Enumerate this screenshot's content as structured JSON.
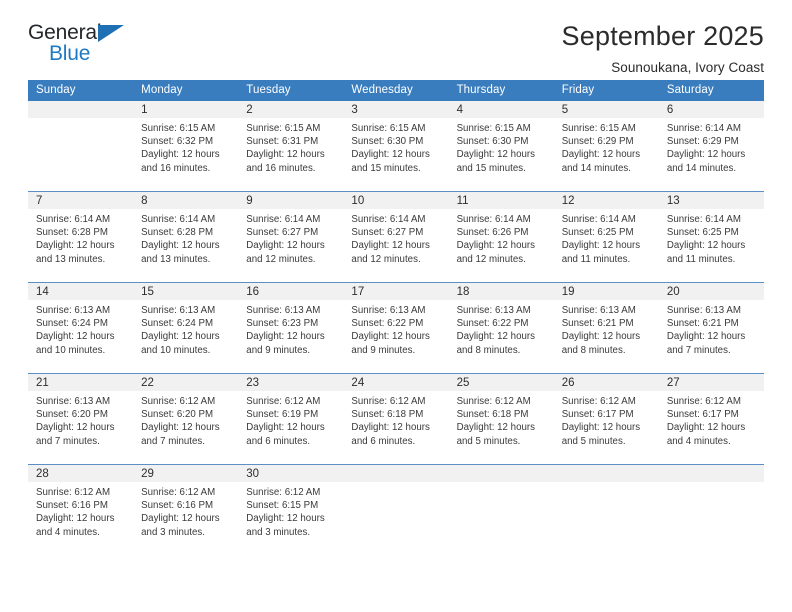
{
  "brand": {
    "logo_primary": "General",
    "logo_secondary": "Blue",
    "triangle_icon": "triangle-icon",
    "accent_color": "#1f6fb4"
  },
  "header": {
    "title": "September 2025",
    "subtitle": "Sounoukana, Ivory Coast"
  },
  "calendar": {
    "header_bg": "#3a7dbe",
    "daynum_bg": "#f1f1f1",
    "weekday_headers": [
      "Sunday",
      "Monday",
      "Tuesday",
      "Wednesday",
      "Thursday",
      "Friday",
      "Saturday"
    ],
    "weeks": [
      [
        {
          "day": "",
          "sunrise": "",
          "sunset": "",
          "daylight_1": "",
          "daylight_2": ""
        },
        {
          "day": "1",
          "sunrise": "Sunrise: 6:15 AM",
          "sunset": "Sunset: 6:32 PM",
          "daylight_1": "Daylight: 12 hours",
          "daylight_2": "and 16 minutes."
        },
        {
          "day": "2",
          "sunrise": "Sunrise: 6:15 AM",
          "sunset": "Sunset: 6:31 PM",
          "daylight_1": "Daylight: 12 hours",
          "daylight_2": "and 16 minutes."
        },
        {
          "day": "3",
          "sunrise": "Sunrise: 6:15 AM",
          "sunset": "Sunset: 6:30 PM",
          "daylight_1": "Daylight: 12 hours",
          "daylight_2": "and 15 minutes."
        },
        {
          "day": "4",
          "sunrise": "Sunrise: 6:15 AM",
          "sunset": "Sunset: 6:30 PM",
          "daylight_1": "Daylight: 12 hours",
          "daylight_2": "and 15 minutes."
        },
        {
          "day": "5",
          "sunrise": "Sunrise: 6:15 AM",
          "sunset": "Sunset: 6:29 PM",
          "daylight_1": "Daylight: 12 hours",
          "daylight_2": "and 14 minutes."
        },
        {
          "day": "6",
          "sunrise": "Sunrise: 6:14 AM",
          "sunset": "Sunset: 6:29 PM",
          "daylight_1": "Daylight: 12 hours",
          "daylight_2": "and 14 minutes."
        }
      ],
      [
        {
          "day": "7",
          "sunrise": "Sunrise: 6:14 AM",
          "sunset": "Sunset: 6:28 PM",
          "daylight_1": "Daylight: 12 hours",
          "daylight_2": "and 13 minutes."
        },
        {
          "day": "8",
          "sunrise": "Sunrise: 6:14 AM",
          "sunset": "Sunset: 6:28 PM",
          "daylight_1": "Daylight: 12 hours",
          "daylight_2": "and 13 minutes."
        },
        {
          "day": "9",
          "sunrise": "Sunrise: 6:14 AM",
          "sunset": "Sunset: 6:27 PM",
          "daylight_1": "Daylight: 12 hours",
          "daylight_2": "and 12 minutes."
        },
        {
          "day": "10",
          "sunrise": "Sunrise: 6:14 AM",
          "sunset": "Sunset: 6:27 PM",
          "daylight_1": "Daylight: 12 hours",
          "daylight_2": "and 12 minutes."
        },
        {
          "day": "11",
          "sunrise": "Sunrise: 6:14 AM",
          "sunset": "Sunset: 6:26 PM",
          "daylight_1": "Daylight: 12 hours",
          "daylight_2": "and 12 minutes."
        },
        {
          "day": "12",
          "sunrise": "Sunrise: 6:14 AM",
          "sunset": "Sunset: 6:25 PM",
          "daylight_1": "Daylight: 12 hours",
          "daylight_2": "and 11 minutes."
        },
        {
          "day": "13",
          "sunrise": "Sunrise: 6:14 AM",
          "sunset": "Sunset: 6:25 PM",
          "daylight_1": "Daylight: 12 hours",
          "daylight_2": "and 11 minutes."
        }
      ],
      [
        {
          "day": "14",
          "sunrise": "Sunrise: 6:13 AM",
          "sunset": "Sunset: 6:24 PM",
          "daylight_1": "Daylight: 12 hours",
          "daylight_2": "and 10 minutes."
        },
        {
          "day": "15",
          "sunrise": "Sunrise: 6:13 AM",
          "sunset": "Sunset: 6:24 PM",
          "daylight_1": "Daylight: 12 hours",
          "daylight_2": "and 10 minutes."
        },
        {
          "day": "16",
          "sunrise": "Sunrise: 6:13 AM",
          "sunset": "Sunset: 6:23 PM",
          "daylight_1": "Daylight: 12 hours",
          "daylight_2": "and 9 minutes."
        },
        {
          "day": "17",
          "sunrise": "Sunrise: 6:13 AM",
          "sunset": "Sunset: 6:22 PM",
          "daylight_1": "Daylight: 12 hours",
          "daylight_2": "and 9 minutes."
        },
        {
          "day": "18",
          "sunrise": "Sunrise: 6:13 AM",
          "sunset": "Sunset: 6:22 PM",
          "daylight_1": "Daylight: 12 hours",
          "daylight_2": "and 8 minutes."
        },
        {
          "day": "19",
          "sunrise": "Sunrise: 6:13 AM",
          "sunset": "Sunset: 6:21 PM",
          "daylight_1": "Daylight: 12 hours",
          "daylight_2": "and 8 minutes."
        },
        {
          "day": "20",
          "sunrise": "Sunrise: 6:13 AM",
          "sunset": "Sunset: 6:21 PM",
          "daylight_1": "Daylight: 12 hours",
          "daylight_2": "and 7 minutes."
        }
      ],
      [
        {
          "day": "21",
          "sunrise": "Sunrise: 6:13 AM",
          "sunset": "Sunset: 6:20 PM",
          "daylight_1": "Daylight: 12 hours",
          "daylight_2": "and 7 minutes."
        },
        {
          "day": "22",
          "sunrise": "Sunrise: 6:12 AM",
          "sunset": "Sunset: 6:20 PM",
          "daylight_1": "Daylight: 12 hours",
          "daylight_2": "and 7 minutes."
        },
        {
          "day": "23",
          "sunrise": "Sunrise: 6:12 AM",
          "sunset": "Sunset: 6:19 PM",
          "daylight_1": "Daylight: 12 hours",
          "daylight_2": "and 6 minutes."
        },
        {
          "day": "24",
          "sunrise": "Sunrise: 6:12 AM",
          "sunset": "Sunset: 6:18 PM",
          "daylight_1": "Daylight: 12 hours",
          "daylight_2": "and 6 minutes."
        },
        {
          "day": "25",
          "sunrise": "Sunrise: 6:12 AM",
          "sunset": "Sunset: 6:18 PM",
          "daylight_1": "Daylight: 12 hours",
          "daylight_2": "and 5 minutes."
        },
        {
          "day": "26",
          "sunrise": "Sunrise: 6:12 AM",
          "sunset": "Sunset: 6:17 PM",
          "daylight_1": "Daylight: 12 hours",
          "daylight_2": "and 5 minutes."
        },
        {
          "day": "27",
          "sunrise": "Sunrise: 6:12 AM",
          "sunset": "Sunset: 6:17 PM",
          "daylight_1": "Daylight: 12 hours",
          "daylight_2": "and 4 minutes."
        }
      ],
      [
        {
          "day": "28",
          "sunrise": "Sunrise: 6:12 AM",
          "sunset": "Sunset: 6:16 PM",
          "daylight_1": "Daylight: 12 hours",
          "daylight_2": "and 4 minutes."
        },
        {
          "day": "29",
          "sunrise": "Sunrise: 6:12 AM",
          "sunset": "Sunset: 6:16 PM",
          "daylight_1": "Daylight: 12 hours",
          "daylight_2": "and 3 minutes."
        },
        {
          "day": "30",
          "sunrise": "Sunrise: 6:12 AM",
          "sunset": "Sunset: 6:15 PM",
          "daylight_1": "Daylight: 12 hours",
          "daylight_2": "and 3 minutes."
        },
        {
          "day": "",
          "sunrise": "",
          "sunset": "",
          "daylight_1": "",
          "daylight_2": ""
        },
        {
          "day": "",
          "sunrise": "",
          "sunset": "",
          "daylight_1": "",
          "daylight_2": ""
        },
        {
          "day": "",
          "sunrise": "",
          "sunset": "",
          "daylight_1": "",
          "daylight_2": ""
        },
        {
          "day": "",
          "sunrise": "",
          "sunset": "",
          "daylight_1": "",
          "daylight_2": ""
        }
      ]
    ]
  }
}
